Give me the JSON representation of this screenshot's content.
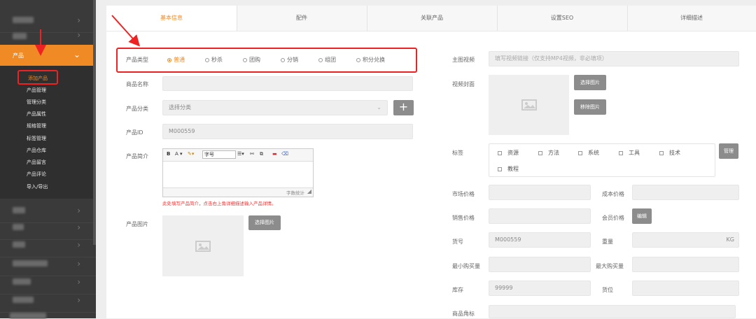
{
  "sidebar": {
    "active_label": "产品",
    "sub_items": [
      "添加产品",
      "产品管理",
      "管理分类",
      "产品属性",
      "规格管理",
      "标签管理",
      "产品仓库",
      "产品留言",
      "产品评论",
      "导入/导出"
    ]
  },
  "tabs": [
    "基本信息",
    "配件",
    "关联产品",
    "设置SEO",
    "详细描述"
  ],
  "form": {
    "type_label": "产品类型",
    "types": [
      "普通",
      "秒杀",
      "团购",
      "分销",
      "组团",
      "积分兑换"
    ],
    "name_label": "商品名称",
    "category_label": "产品分类",
    "category_placeholder": "选择分类",
    "id_label": "产品ID",
    "id_value": "M000559",
    "intro_label": "产品简介",
    "editor_font": "字号",
    "editor_count": "字数统计",
    "intro_hint": "此处填写产品简介，点击右上角详细描述输入产品详情。",
    "image_label": "产品图片",
    "select_image": "选择图片"
  },
  "right": {
    "video_label": "主图视频",
    "video_placeholder": "填写视频链接（仅支持MP4视频，非必填项）",
    "cover_label": "视频封面",
    "select_image": "选择图片",
    "remove_image": "移除图片",
    "tags_label": "标签",
    "tags": [
      "资源",
      "方法",
      "系统",
      "工具",
      "技术",
      "教程"
    ],
    "manage": "管理",
    "market_price": "市场价格",
    "cost_price": "成本价格",
    "sale_price": "销售价格",
    "member_price": "会员价格",
    "edit": "编辑",
    "sku_label": "货号",
    "sku_value": "M000559",
    "weight_label": "重量",
    "weight_unit": "KG",
    "min_buy": "最小购买量",
    "max_buy": "最大购买量",
    "stock_label": "库存",
    "stock_value": "99999",
    "location_label": "货位",
    "corner_label": "商品角标"
  },
  "icons": [
    "chevron-right-icon",
    "chevron-down-icon",
    "image-icon",
    "plus-icon",
    "dropdown-icon",
    "arrow-annotation-icon"
  ]
}
